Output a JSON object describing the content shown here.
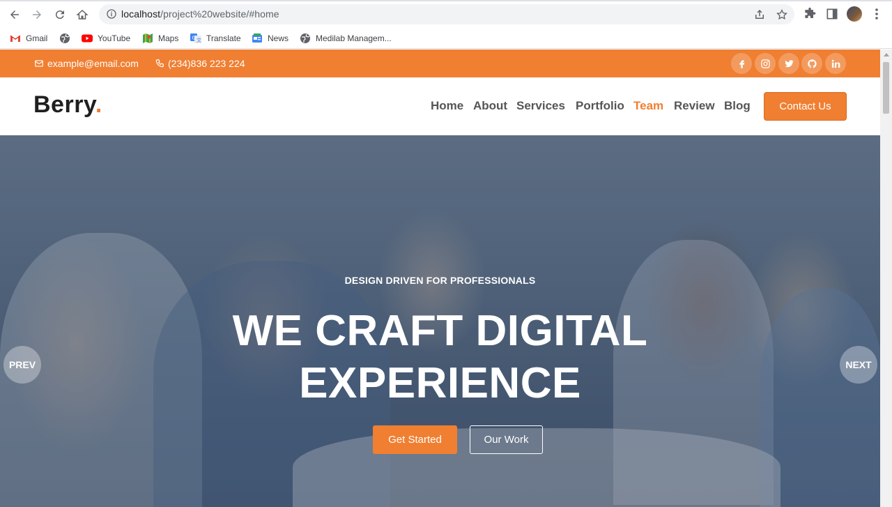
{
  "browser": {
    "url_host": "localhost",
    "url_path": "/project%20website/#home",
    "bookmarks": [
      {
        "label": "Gmail",
        "icon": "gmail-icon"
      },
      {
        "label": "",
        "icon": "globe-icon"
      },
      {
        "label": "YouTube",
        "icon": "youtube-icon"
      },
      {
        "label": "Maps",
        "icon": "maps-icon"
      },
      {
        "label": "Translate",
        "icon": "translate-icon"
      },
      {
        "label": "News",
        "icon": "news-icon"
      },
      {
        "label": "Medilab Managem...",
        "icon": "globe-icon"
      }
    ]
  },
  "topbar": {
    "email": "example@email.com",
    "phone": "(234)836 223 224",
    "social": [
      "facebook-icon",
      "instagram-icon",
      "twitter-icon",
      "github-icon",
      "linkedin-icon"
    ]
  },
  "header": {
    "logo_text": "Berry",
    "logo_dot": ".",
    "nav": [
      "Home",
      "About",
      "Services",
      "Portfolio",
      "Team",
      "Review",
      "Blog"
    ],
    "active_nav": "Team",
    "contact_label": "Contact Us"
  },
  "hero": {
    "subtitle": "DESIGN DRIVEN FOR PROFESSIONALS",
    "title_line1": "WE CRAFT DIGITAL",
    "title_line2": "EXPERIENCE",
    "primary_button": "Get Started",
    "secondary_button": "Our Work",
    "prev_label": "PREV",
    "next_label": "NEXT"
  },
  "colors": {
    "accent": "#f07f32",
    "text_dark": "#1f1f1f",
    "nav_text": "#555555"
  }
}
